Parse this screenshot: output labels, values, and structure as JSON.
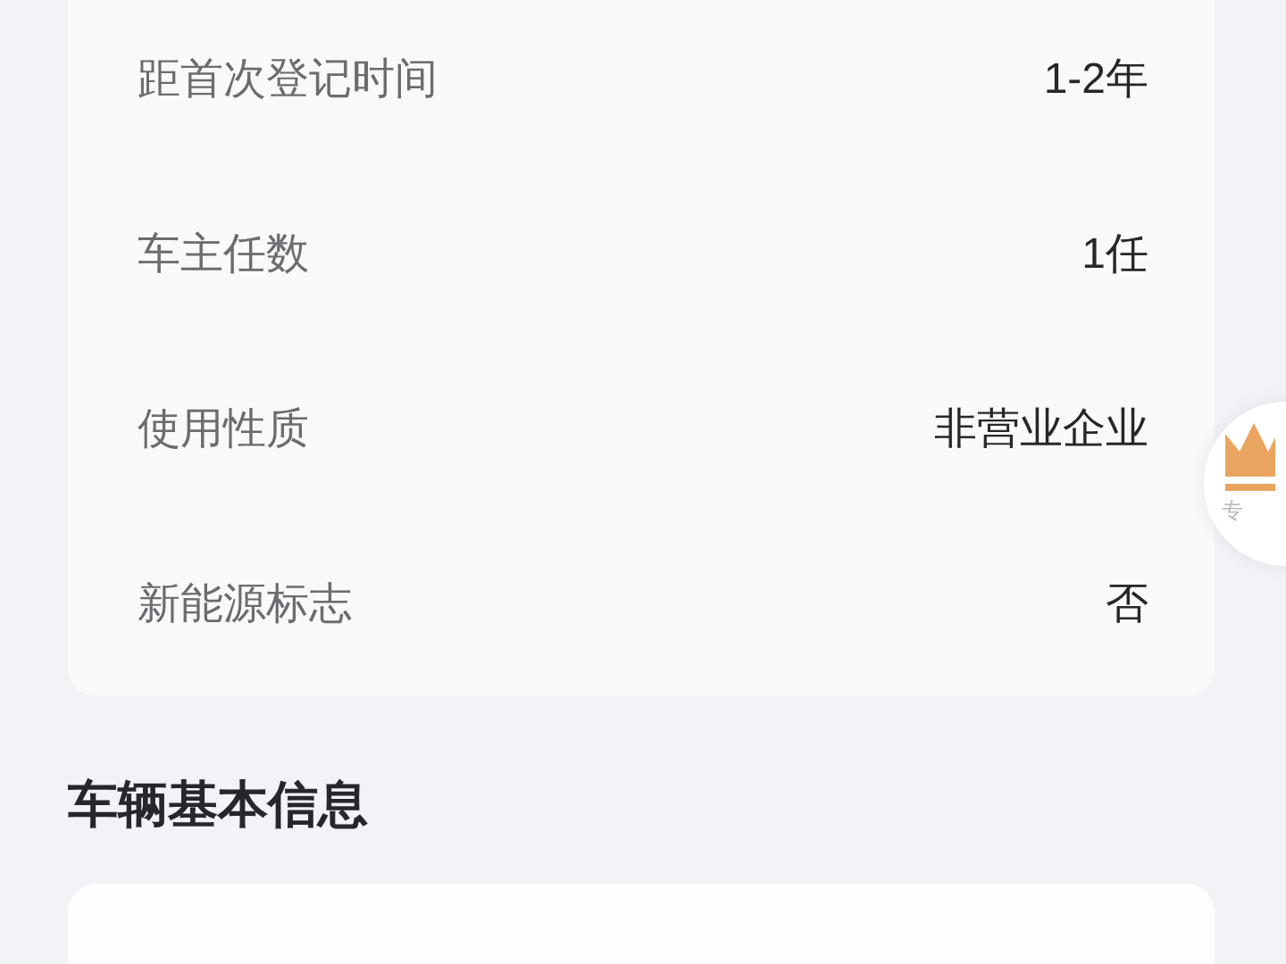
{
  "info_rows": [
    {
      "label": "距首次登记时间",
      "value": "1-2年"
    },
    {
      "label": "车主任数",
      "value": "1任"
    },
    {
      "label": "使用性质",
      "value": "非营业企业"
    },
    {
      "label": "新能源标志",
      "value": "否"
    }
  ],
  "section_title": "车辆基本信息",
  "float_badge": {
    "label": "专"
  }
}
